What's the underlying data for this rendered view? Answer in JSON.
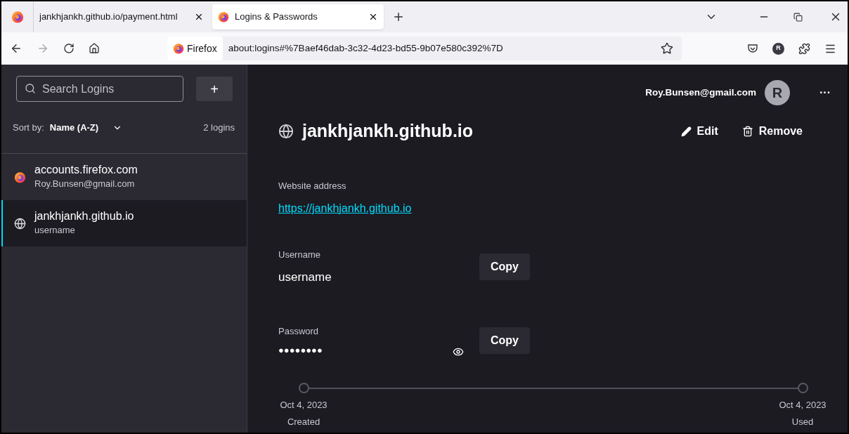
{
  "tabs": [
    {
      "label": "jankhjankh.github.io/payment.html",
      "selected": false
    },
    {
      "label": "Logins & Passwords",
      "selected": true
    }
  ],
  "address_bar": {
    "identity": "Firefox",
    "url": "about:logins#%7Baef46dab-3c32-4d23-bd55-9b07e580c392%7D"
  },
  "toolbar": {
    "account_initial": "R"
  },
  "sidebar": {
    "search": {
      "placeholder": "Search Logins"
    },
    "add_button": "+",
    "sort_label": "Sort by:",
    "sort_value": "Name (A-Z)",
    "count": "2 logins",
    "items": [
      {
        "kind": "firefox",
        "title": "accounts.firefox.com",
        "subtitle": "Roy.Bunsen@gmail.com",
        "selected": false
      },
      {
        "kind": "globe",
        "title": "jankhjankh.github.io",
        "subtitle": "username",
        "selected": true
      }
    ]
  },
  "header": {
    "email": "Roy.Bunsen@gmail.com",
    "avatar": "R",
    "menu": "···"
  },
  "detail": {
    "title": "jankhjankh.github.io",
    "edit": "Edit",
    "remove": "Remove",
    "website_label": "Website address",
    "website": "https://jankhjankh.github.io",
    "username_label": "Username",
    "username": "username",
    "password_label": "Password",
    "password": "●●●●●●●●",
    "username_copy": "Copy",
    "password_copy": "Copy",
    "timeline": [
      {
        "date": "Oct 4, 2023",
        "label": "Created"
      },
      {
        "date": "Oct 4, 2023",
        "label": "Used"
      }
    ]
  }
}
